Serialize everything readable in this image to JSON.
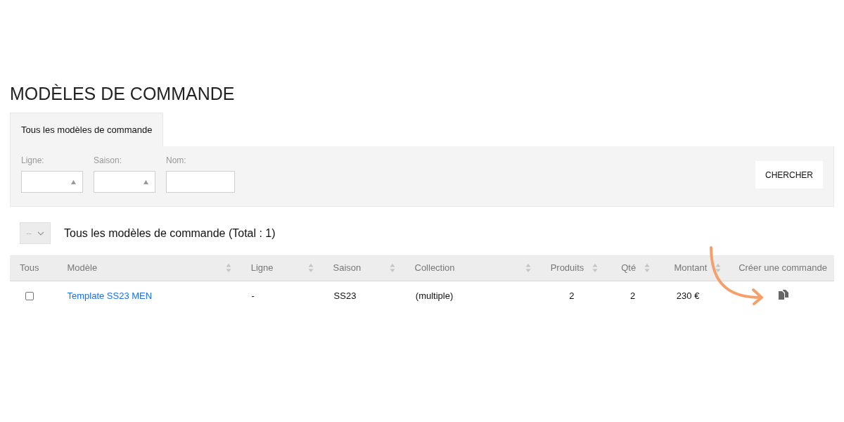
{
  "title": "MODÈLES DE COMMANDE",
  "tabs": [
    {
      "label": "Tous les modèles de commande",
      "selected": true
    }
  ],
  "filters": [
    {
      "kind": "select",
      "label": "Ligne:"
    },
    {
      "kind": "select",
      "label": "Saison:"
    },
    {
      "kind": "text",
      "label": "Nom:"
    }
  ],
  "search_button": "CHERCHER",
  "bulk_select": {
    "value": "--"
  },
  "list_title": "Tous les modèles de commande (Total : 1)",
  "table": {
    "columns": [
      {
        "label": "Tous",
        "sortable": false
      },
      {
        "label": "Modèle",
        "sortable": true
      },
      {
        "label": "Ligne",
        "sortable": true
      },
      {
        "label": "Saison",
        "sortable": true
      },
      {
        "label": "Collection",
        "sortable": true
      },
      {
        "label": "Produits",
        "sortable": true
      },
      {
        "label": "Qté",
        "sortable": true
      },
      {
        "label": "Montant",
        "sortable": true
      },
      {
        "label": "Créer une commande",
        "sortable": false
      }
    ],
    "rows": [
      {
        "checked": false,
        "name": "Template SS23 MEN",
        "ligne": "-",
        "saison": "SS23",
        "collection": "(multiple)",
        "produits": "2",
        "qte": "2",
        "montant": "230 €"
      }
    ]
  }
}
